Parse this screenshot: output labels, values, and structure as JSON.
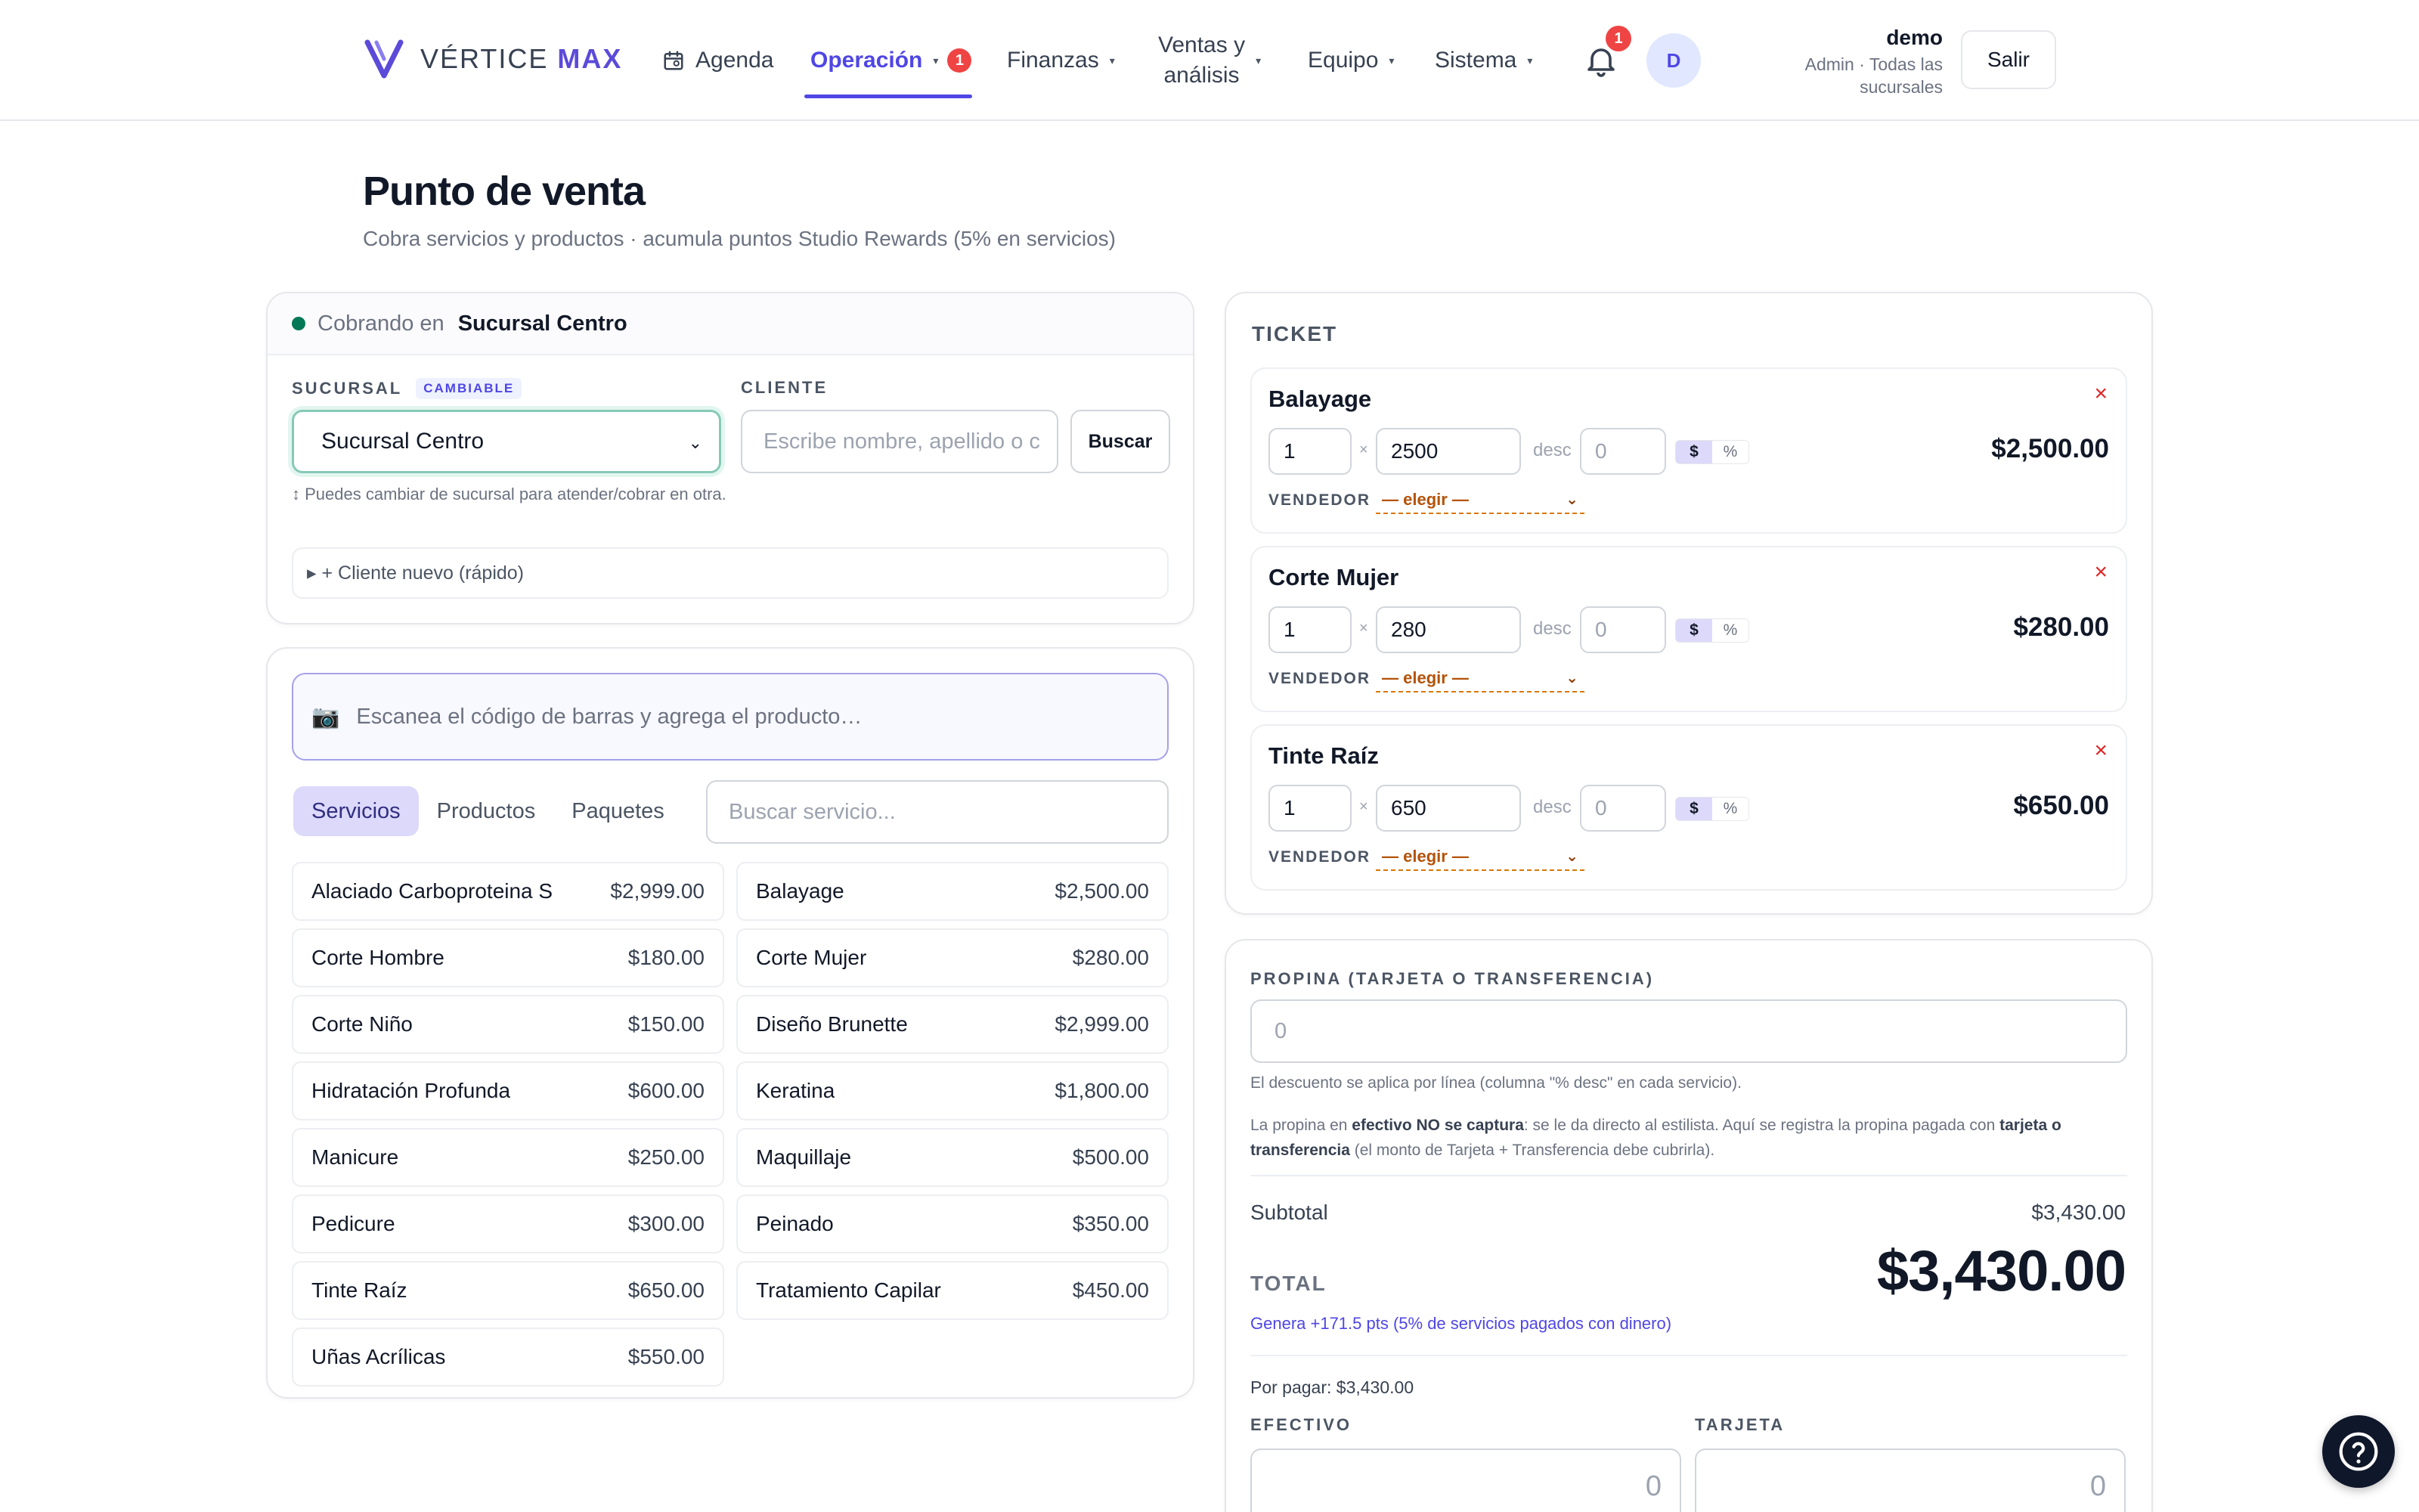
{
  "brand": {
    "name_light": "VÉRTICE",
    "name_bold": "MAX",
    "accent": "#4f46e5"
  },
  "nav": {
    "agenda": "Agenda",
    "operacion": "Operación",
    "operacion_badge": "1",
    "finanzas": "Finanzas",
    "ventas_line1": "Ventas y",
    "ventas_line2": "análisis",
    "equipo": "Equipo",
    "sistema": "Sistema",
    "notifications_badge": "1",
    "avatar_initial": "D"
  },
  "user": {
    "name": "demo",
    "role_line1": "Admin · Todas las",
    "role_line2": "sucursales",
    "logout": "Salir"
  },
  "page": {
    "title": "Punto de venta",
    "subtitle": "Cobra servicios y productos · acumula puntos Studio Rewards (5% en servicios)"
  },
  "branch_card": {
    "charging_prefix": "Cobrando en",
    "charging_branch": "Sucursal Centro",
    "sucursal_label": "SUCURSAL",
    "cambiable_badge": "CAMBIABLE",
    "sucursal_value": "Sucursal Centro",
    "hint": "↕ Puedes cambiar de sucursal para atender/cobrar en otra.",
    "cliente_label": "CLIENTE",
    "cliente_placeholder": "Escribe nombre, apellido o c",
    "buscar": "Buscar",
    "new_client": "▸ + Cliente nuevo (rápido)"
  },
  "catalog": {
    "scan_placeholder": "Escanea el código de barras y agrega el producto…",
    "tabs": [
      "Servicios",
      "Productos",
      "Paquetes"
    ],
    "search_placeholder": "Buscar servicio...",
    "services": [
      {
        "name": "Alaciado Carboproteina S",
        "price": "$2,999.00"
      },
      {
        "name": "Balayage",
        "price": "$2,500.00"
      },
      {
        "name": "Corte Hombre",
        "price": "$180.00"
      },
      {
        "name": "Corte Mujer",
        "price": "$280.00"
      },
      {
        "name": "Corte Niño",
        "price": "$150.00"
      },
      {
        "name": "Diseño Brunette",
        "price": "$2,999.00"
      },
      {
        "name": "Hidratación Profunda",
        "price": "$600.00"
      },
      {
        "name": "Keratina",
        "price": "$1,800.00"
      },
      {
        "name": "Manicure",
        "price": "$250.00"
      },
      {
        "name": "Maquillaje",
        "price": "$500.00"
      },
      {
        "name": "Pedicure",
        "price": "$300.00"
      },
      {
        "name": "Peinado",
        "price": "$350.00"
      },
      {
        "name": "Tinte Raíz",
        "price": "$650.00"
      },
      {
        "name": "Tratamiento Capilar",
        "price": "$450.00"
      },
      {
        "name": "Uñas Acrílicas",
        "price": "$550.00"
      }
    ]
  },
  "ticket": {
    "title": "TICKET",
    "times": "×",
    "desc_label": "desc",
    "vendor_label": "VENDEDOR",
    "vendor_value": "— elegir —",
    "remove": "×",
    "toggle_money": "$",
    "toggle_pct": "%",
    "items": [
      {
        "name": "Balayage",
        "qty": "1",
        "unit": "2500",
        "desc": "0",
        "total": "$2,500.00"
      },
      {
        "name": "Corte Mujer",
        "qty": "1",
        "unit": "280",
        "desc": "0",
        "total": "$280.00"
      },
      {
        "name": "Tinte Raíz",
        "qty": "1",
        "unit": "650",
        "desc": "0",
        "total": "$650.00"
      }
    ]
  },
  "totals": {
    "tip_label": "PROPINA (TARJETA O TRANSFERENCIA)",
    "tip_placeholder": "0",
    "note1": "El descuento se aplica por línea (columna \"% desc\" en cada servicio).",
    "note2_a": "La propina en ",
    "note2_b": "efectivo NO se captura",
    "note2_c": ": se le da directo al estilista. Aquí se registra la propina pagada con ",
    "note2_d": "tarjeta o transferencia",
    "note2_e": " (el monto de Tarjeta + Transferencia debe cubrirla).",
    "subtotal_label": "Subtotal",
    "subtotal_value": "$3,430.00",
    "total_label": "TOTAL",
    "total_value": "$3,430.00",
    "points": "Genera +171.5 pts (5% de servicios pagados con dinero)",
    "por_pagar": "Por pagar: $3,430.00",
    "efectivo_label": "EFECTIVO",
    "efectivo_placeholder": "0",
    "tarjeta_label": "TARJETA",
    "tarjeta_placeholder": "0"
  }
}
